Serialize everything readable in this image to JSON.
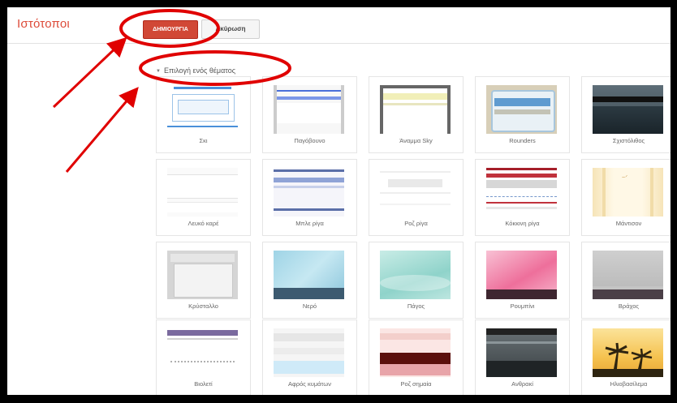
{
  "header": {
    "title": "Ιστότοποι",
    "create_label": "ΔΗΜΙΟΥΡΓΙΑ",
    "cancel_label": "Ακύρωση"
  },
  "section": {
    "label": "Επιλογή ενός θέματος"
  },
  "themes": [
    "Σκι",
    "Παγόβουνο",
    "Άναμμα Sky",
    "Rounders",
    "Σχιστόλιθος",
    "Λευκό καρέ",
    "Μπλε ρίγα",
    "Ροζ ρίγα",
    "Κόκκινη ρίγα",
    "Μάντισον",
    "Κρύσταλλο",
    "Νερό",
    "Πάγος",
    "Ρουμπίνι",
    "Βράχος",
    "Βιολετί",
    "Αφρός κυμάτων",
    "Ροζ σημαία",
    "Ανθρακί",
    "Ηλιοβασίλεμα"
  ],
  "colors": {
    "accent": "#dd4b39",
    "create_button": "#d14836",
    "annotation": "#e00000"
  }
}
